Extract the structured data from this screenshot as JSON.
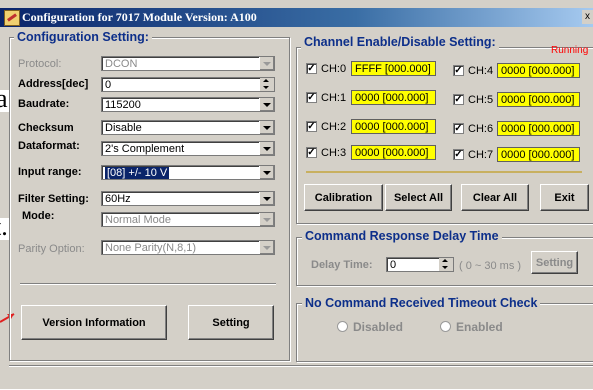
{
  "window": {
    "title": "Configuration for 7017 Module Version: A100",
    "close_glyph": "x"
  },
  "config": {
    "group_label": "Configuration Setting:",
    "fields": {
      "protocol": {
        "label": "Protocol:",
        "value": "DCON"
      },
      "address": {
        "label": "Address[dec]",
        "value": "0"
      },
      "baudrate": {
        "label": "Baudrate:",
        "value": "115200"
      },
      "checksum": {
        "label": "Checksum",
        "value": "Disable"
      },
      "dataformat": {
        "label": "Dataformat:",
        "value": "2's Complement"
      },
      "input_range": {
        "label": "Input range:",
        "value": "[08] +/- 10 V"
      },
      "filter": {
        "label": "Filter Setting:",
        "value": "60Hz"
      },
      "mode": {
        "label": "Mode:",
        "value": "Normal Mode"
      },
      "parity": {
        "label": "Parity Option:",
        "value": "None Parity(N,8,1)"
      }
    },
    "version_button": "Version Information",
    "setting_button": "Setting"
  },
  "channels": {
    "group_label": "Channel Enable/Disable Setting:",
    "status": "Running",
    "status_color": "#ff0000",
    "items": [
      {
        "label": "CH:0",
        "value": "FFFF  [000.000]",
        "checked": "✓"
      },
      {
        "label": "CH:1",
        "value": "0000  [000.000]",
        "checked": "✓"
      },
      {
        "label": "CH:2",
        "value": "0000  [000.000]",
        "checked": "✓"
      },
      {
        "label": "CH:3",
        "value": "0000  [000.000]",
        "checked": "✓"
      },
      {
        "label": "CH:4",
        "value": "0000  [000.000]",
        "checked": "✓"
      },
      {
        "label": "CH:5",
        "value": "0000  [000.000]",
        "checked": "✓"
      },
      {
        "label": "CH:6",
        "value": "0000  [000.000]",
        "checked": "✓"
      },
      {
        "label": "CH:7",
        "value": "0000  [000.000]",
        "checked": "✓"
      }
    ],
    "buttons": {
      "calibration": "Calibration",
      "select_all": "Select All",
      "clear_all": "Clear All",
      "exit": "Exit"
    }
  },
  "delay": {
    "group_label": "Command Response Delay Time",
    "label": "Delay Time:",
    "value": "0",
    "range": "( 0 ~ 30 ms )",
    "button": "Setting"
  },
  "timeout": {
    "group_label": "No Command Received Timeout Check",
    "disabled": "Disabled",
    "enabled": "Enabled"
  },
  "background": {
    "letter_a": "a",
    "letter_t": "t.",
    "arrow_color": "#e02020"
  }
}
